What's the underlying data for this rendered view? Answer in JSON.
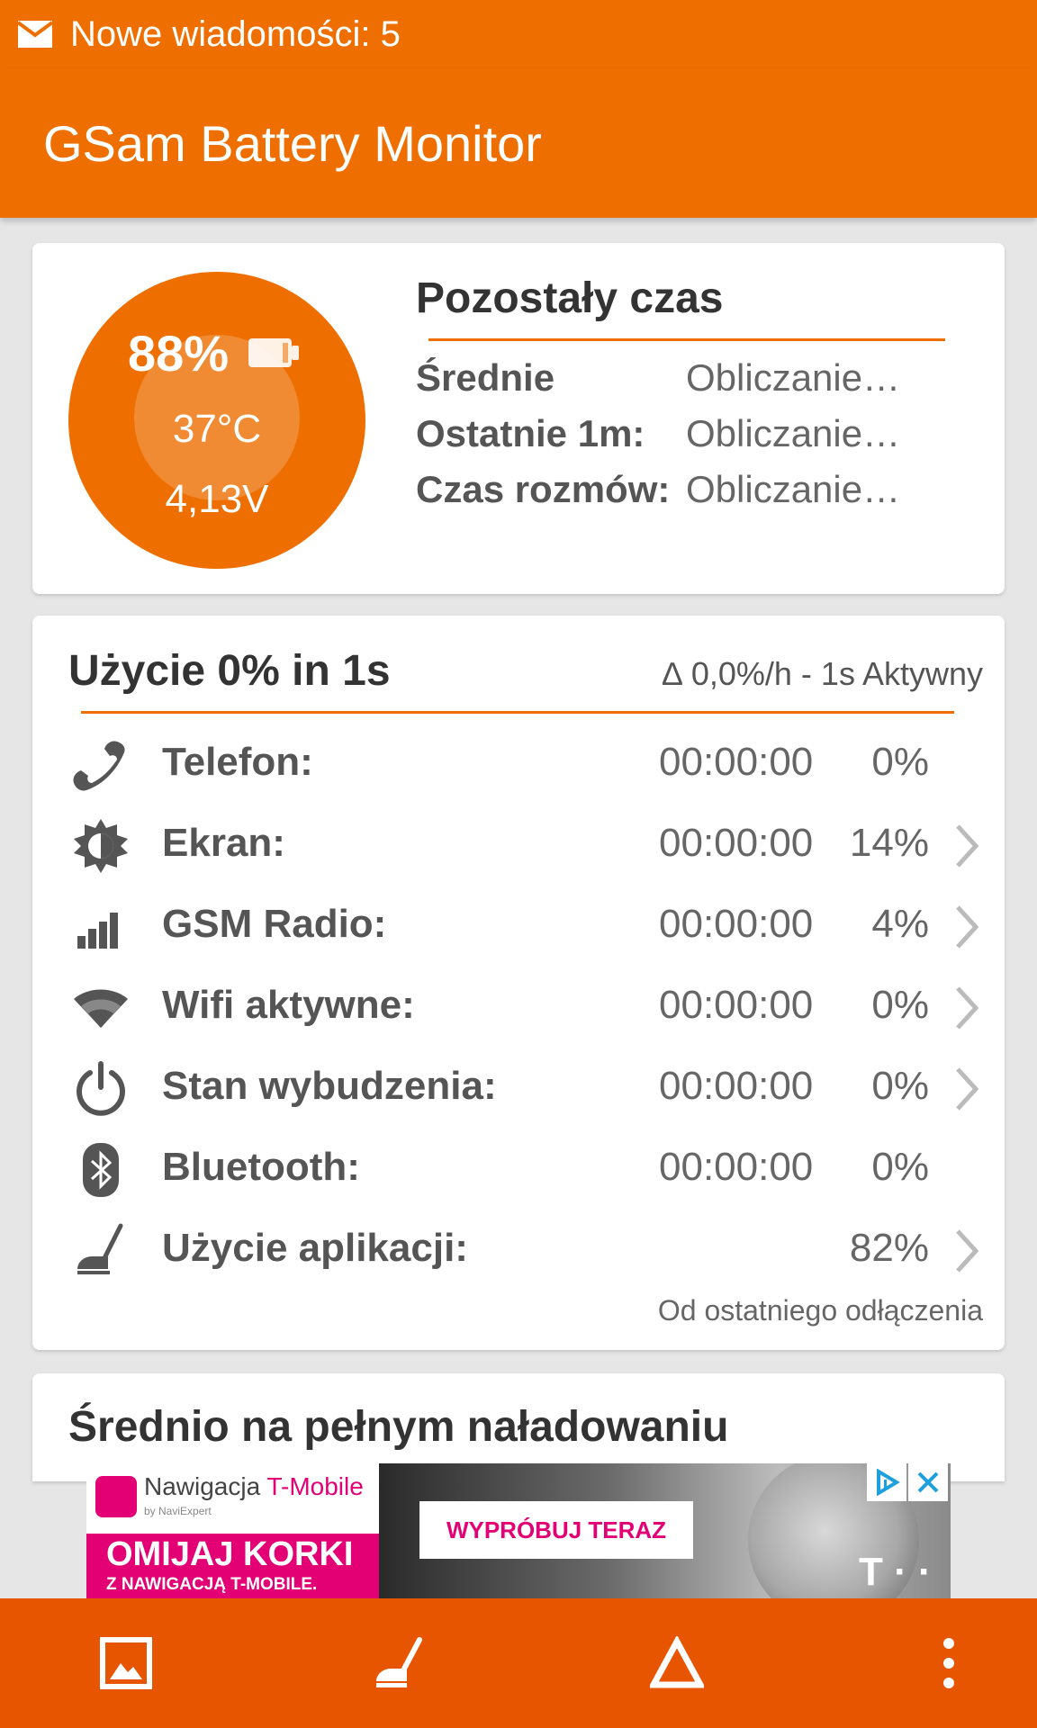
{
  "status_bar": {
    "notification": "Nowe wiadomości: 5",
    "icon": "mail-icon"
  },
  "app_bar": {
    "title": "GSam Battery Monitor"
  },
  "battery": {
    "level": "88%",
    "temperature": "37°C",
    "voltage": "4,13V",
    "icon": "battery-icon"
  },
  "remaining": {
    "title": "Pozostały czas",
    "rows": [
      {
        "label": "Średnie",
        "value": "Obliczanie…"
      },
      {
        "label": "Ostatnie 1m:",
        "value": "Obliczanie…"
      },
      {
        "label": "Czas rozmów:",
        "value": "Obliczanie…"
      }
    ]
  },
  "usage": {
    "title": "Użycie 0% in 1s",
    "delta": "∆ 0,0%/h - 1s Aktywny",
    "rows": [
      {
        "icon": "phone-icon",
        "name": "Telefon:",
        "time": "00:00:00",
        "pct": "0%",
        "has_arrow": false
      },
      {
        "icon": "brightness-icon",
        "name": "Ekran:",
        "time": "00:00:00",
        "pct": "14%",
        "has_arrow": true
      },
      {
        "icon": "signal-bars-icon",
        "name": "GSM Radio:",
        "time": "00:00:00",
        "pct": "4%",
        "has_arrow": true
      },
      {
        "icon": "wifi-icon",
        "name": "Wifi aktywne:",
        "time": "00:00:00",
        "pct": "0%",
        "has_arrow": true
      },
      {
        "icon": "power-icon",
        "name": "Stan wybudzenia:",
        "time": "00:00:00",
        "pct": "0%",
        "has_arrow": true
      },
      {
        "icon": "bluetooth-icon",
        "name": "Bluetooth:",
        "time": "00:00:00",
        "pct": "0%",
        "has_arrow": false
      },
      {
        "icon": "broom-icon",
        "name": "Użycie aplikacji:",
        "time": "",
        "pct": "82%",
        "has_arrow": true
      }
    ],
    "footnote": "Od ostatniego odłączenia"
  },
  "average_card": {
    "title": "Średnio na pełnym naładowaniu"
  },
  "ad": {
    "brand_prefix": "Nawigacja ",
    "brand_highlight": "T-Mobile",
    "brand_sub": "by NaviExpert",
    "slogan_main": "OMIJAJ KORKI",
    "slogan_sub": "Z NAWIGACJĄ T-MOBILE.",
    "cta": "WYPRÓBUJ TERAZ",
    "corner_logo": "T · ·"
  },
  "bottom_bar": {
    "buttons": [
      "image-icon",
      "broom-icon",
      "delta-icon",
      "more-vert-icon"
    ]
  },
  "colors": {
    "accent": "#ee6f00",
    "bottom_bar": "#e85500",
    "ad_magenta": "#e20074"
  }
}
